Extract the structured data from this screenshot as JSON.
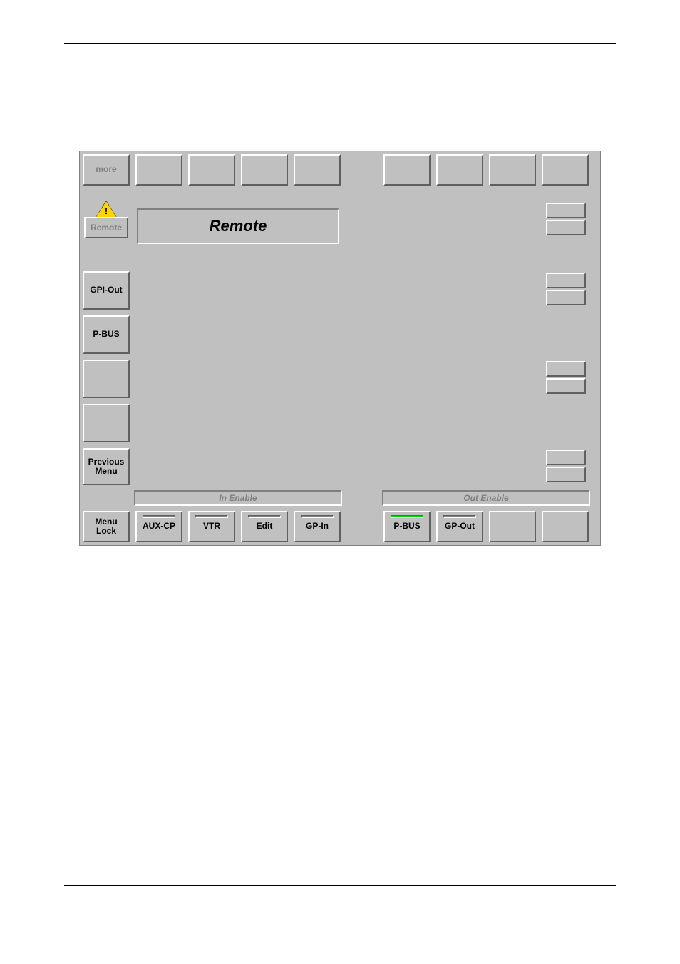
{
  "top_row": {
    "more": "more"
  },
  "title": "Remote",
  "warning_symbol": "!",
  "left_buttons": {
    "remote": "Remote",
    "gpi_out": "GPI-Out",
    "p_bus": "P-BUS",
    "previous_menu_line1": "Previous",
    "previous_menu_line2": "Menu"
  },
  "group_labels": {
    "in_enable": "In Enable",
    "out_enable": "Out Enable"
  },
  "bottom_row": {
    "menu_lock_line1": "Menu",
    "menu_lock_line2": "Lock",
    "aux_cp": "AUX-CP",
    "vtr": "VTR",
    "edit": "Edit",
    "gp_in": "GP-In",
    "p_bus": "P-BUS",
    "gp_out": "GP-Out"
  },
  "indicators": {
    "aux_cp_on": false,
    "vtr_on": false,
    "edit_on": false,
    "gp_in_on": false,
    "p_bus_on": true,
    "gp_out_on": false
  }
}
